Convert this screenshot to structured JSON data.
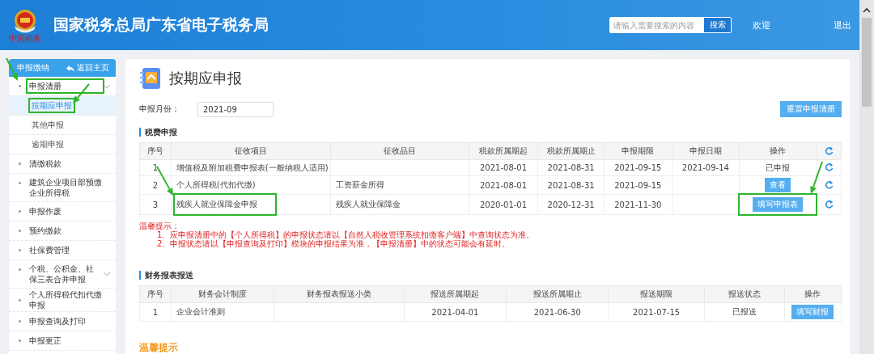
{
  "header": {
    "title": "国家税务总局广东省电子税务局",
    "logo_caption": "中国税务",
    "search": {
      "placeholder": "请输入需要搜索的内容",
      "button": "搜索"
    },
    "welcome": "欢迎",
    "logout": "退出"
  },
  "sidebar": {
    "title": "申报缴纳",
    "back_link": "返回主页",
    "items": [
      {
        "label": "申报清册",
        "kind": "group",
        "highlighted": true,
        "children": [
          {
            "label": "按期应申报",
            "selected": true,
            "highlighted": true
          },
          {
            "label": "其他申报",
            "selected": false,
            "highlighted": false
          },
          {
            "label": "逾期申报",
            "selected": false,
            "highlighted": false
          }
        ]
      },
      {
        "label": "清缴税款",
        "kind": "link",
        "highlighted": false
      },
      {
        "label": "建筑企业项目部预缴企业所得税",
        "kind": "link",
        "highlighted": false
      },
      {
        "label": "申报作废",
        "kind": "link",
        "highlighted": false
      },
      {
        "label": "预约缴款",
        "kind": "link",
        "highlighted": false
      },
      {
        "label": "社保费管理",
        "kind": "link",
        "highlighted": false
      },
      {
        "label": "个税、公积金、社保三表合并申报",
        "kind": "group",
        "highlighted": false
      },
      {
        "label": "个人所得税代扣代缴申报",
        "kind": "link",
        "highlighted": false
      },
      {
        "label": "申报查询及打印",
        "kind": "link",
        "highlighted": false
      },
      {
        "label": "申报更正",
        "kind": "link",
        "highlighted": false
      }
    ]
  },
  "page": {
    "title": "按期应申报",
    "month_label": "申报月份：",
    "month_value": "2021-09",
    "reset_button": "重置申报清册"
  },
  "tax_section": {
    "title": "税费申报",
    "columns": [
      "序号",
      "征收项目",
      "征收品目",
      "税款所属期起",
      "税款所属期止",
      "申报期限",
      "申报日期",
      "操作"
    ],
    "rows": [
      {
        "cells": [
          "1",
          "增值税及附加税费申报表(一般纳税人适用)",
          "",
          "2021-08-01",
          "2021-08-31",
          "2021-09-15",
          "2021-09-14"
        ],
        "action": {
          "kind": "text",
          "label": "已申报"
        },
        "highlighted": false
      },
      {
        "cells": [
          "2",
          "个人所得税(代扣代缴)",
          "工资薪金所得",
          "2021-08-01",
          "2021-08-31",
          "2021-09-15",
          ""
        ],
        "action": {
          "kind": "button",
          "label": "查看"
        },
        "highlighted": false
      },
      {
        "cells": [
          "3",
          "残疾人就业保障金申报",
          "残疾人就业保障金",
          "2020-01-01",
          "2020-12-31",
          "2021-11-30",
          ""
        ],
        "action": {
          "kind": "button",
          "label": "填写申报表"
        },
        "highlighted": true
      }
    ]
  },
  "notes": {
    "title": "温馨提示：",
    "lines": [
      "1、应申报清册中的【个人所得税】的申报状态请以【自然人税收管理系统扣缴客户端】中查询状态为准。",
      "2、申报状态请以【申报查询及打印】模块的申报结果为准，【申报清册】中的状态可能会有延时。"
    ]
  },
  "finance_section": {
    "title": "财务报表报送",
    "columns": [
      "序号",
      "财务会计制度",
      "财务报表报送小类",
      "报送所属期起",
      "报送所属期止",
      "报送期限",
      "报送状态",
      "操作"
    ],
    "rows": [
      {
        "cells": [
          "1",
          "企业会计准则",
          "",
          "2021-04-01",
          "2021-06-30",
          "2021-07-15",
          "已报送"
        ],
        "action": {
          "kind": "button",
          "label": "填写财报"
        },
        "highlighted": false
      }
    ]
  },
  "footer_tip": "温馨提示"
}
